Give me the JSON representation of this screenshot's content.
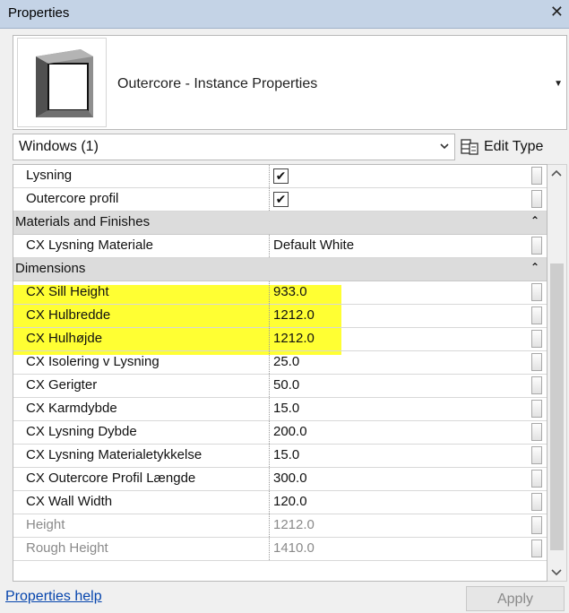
{
  "window": {
    "title": "Properties",
    "close_glyph": "✕"
  },
  "type_selector": {
    "name": "Outercore - Instance Properties",
    "arrow": "▼"
  },
  "filter": {
    "selected": "Windows (1)",
    "edit_type_label": "Edit Type"
  },
  "grid": {
    "rows": [
      {
        "kind": "param",
        "name": "Lysning",
        "check": true
      },
      {
        "kind": "param",
        "name": "Outercore profil",
        "check": true
      },
      {
        "kind": "group",
        "name": "Materials and Finishes",
        "collapse": "⌃"
      },
      {
        "kind": "param",
        "name": "CX Lysning Materiale",
        "value": "Default White"
      },
      {
        "kind": "group",
        "name": "Dimensions",
        "collapse": "⌃"
      },
      {
        "kind": "param",
        "name": "CX Sill Height",
        "value": "933.0",
        "highlight": true
      },
      {
        "kind": "param",
        "name": "CX Hulbredde",
        "value": "1212.0",
        "highlight": true
      },
      {
        "kind": "param",
        "name": "CX Hulhøjde",
        "value": "1212.0",
        "highlight": true
      },
      {
        "kind": "param",
        "name": "CX Isolering v Lysning",
        "value": "25.0"
      },
      {
        "kind": "param",
        "name": "CX Gerigter",
        "value": "50.0"
      },
      {
        "kind": "param",
        "name": "CX Karmdybde",
        "value": "15.0"
      },
      {
        "kind": "param",
        "name": "CX Lysning Dybde",
        "value": "200.0"
      },
      {
        "kind": "param",
        "name": "CX Lysning Materialetykkelse",
        "value": "15.0"
      },
      {
        "kind": "param",
        "name": "CX Outercore Profil Længde",
        "value": "300.0"
      },
      {
        "kind": "param",
        "name": "CX Wall Width",
        "value": "120.0"
      },
      {
        "kind": "param",
        "name": "Height",
        "value": "1212.0",
        "dim": true
      },
      {
        "kind": "param",
        "name": "Rough Height",
        "value": "1410.0",
        "dim": true
      }
    ]
  },
  "footer": {
    "help_link": "Properties help",
    "apply_label": "Apply"
  },
  "icons": {
    "window_thumb": "window-thumbnail-icon",
    "edit_type": "edit-type-icon",
    "checkmark": "✔"
  },
  "colors": {
    "highlight": "#ffff33",
    "group_bg": "#dcdcdc",
    "title_bg": "#c4d3e6",
    "link": "#0645ad"
  }
}
